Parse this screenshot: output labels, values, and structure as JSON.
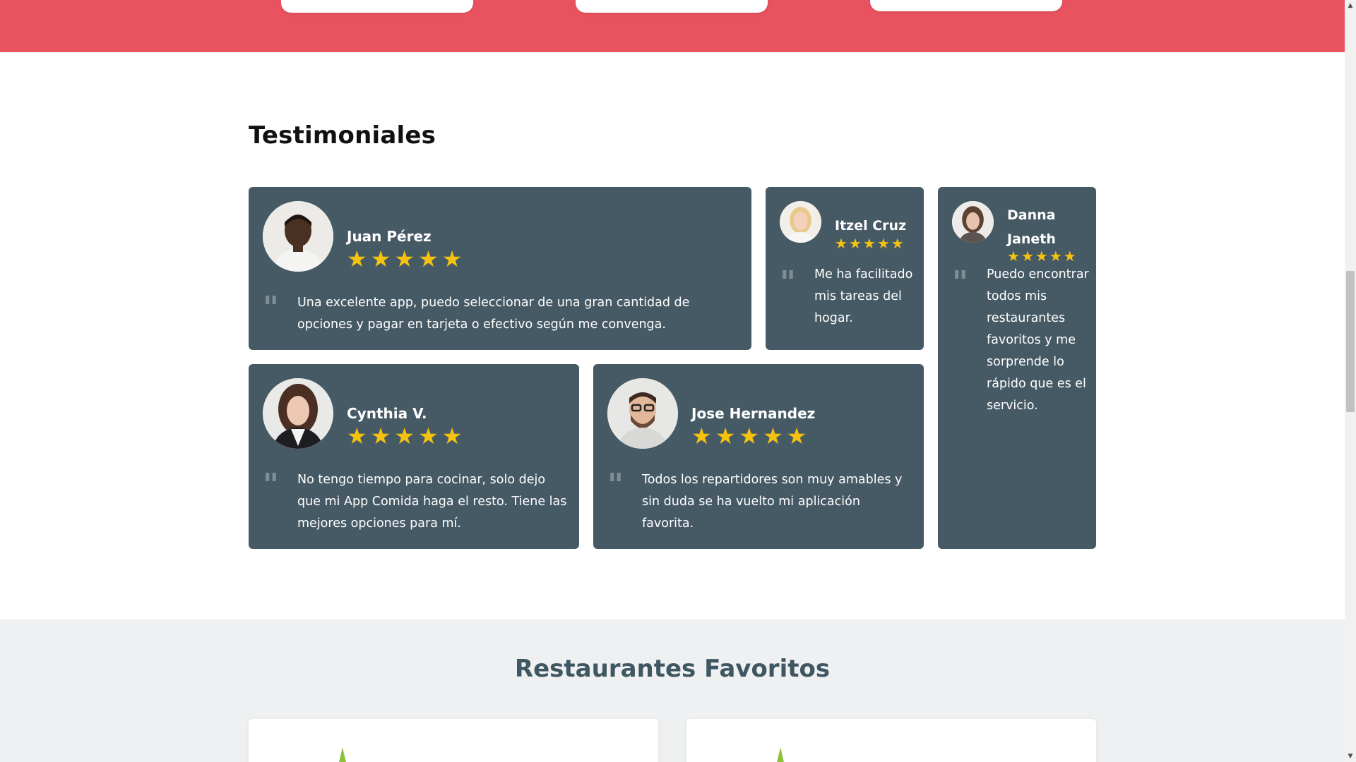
{
  "testimonials": {
    "title": "Testimoniales",
    "items": [
      {
        "name": "Juan Pérez",
        "rating": 5,
        "text": "Una excelente app, puedo seleccionar de una gran cantidad de opciones y pagar en tarjeta o efectivo según me convenga."
      },
      {
        "name": "Itzel Cruz",
        "rating": 5,
        "text": "Me ha facilitado mis tareas del hogar."
      },
      {
        "name": "Danna Janeth",
        "rating": 5,
        "text": "Puedo encontrar todos mis restaurantes favoritos y me sorprende lo rápido que es el servicio."
      },
      {
        "name": "Cynthia V.",
        "rating": 5,
        "text": "No tengo tiempo para cocinar, solo dejo que mi App Comida haga el resto. Tiene las mejores opciones para mí."
      },
      {
        "name": "Jose Hernandez",
        "rating": 5,
        "text": "Todos los repartidores son muy amables y sin duda se ha vuelto mi aplicación favorita."
      }
    ],
    "quote_glyph": "\"",
    "star_glyph": "★"
  },
  "favorites": {
    "title": "Restaurantes Favoritos"
  },
  "colors": {
    "top_band": "#e9535f",
    "card_bg": "#465a65",
    "star": "#f5c20f",
    "favorites_title": "#3f5762",
    "favorites_bg": "#eef0f1"
  },
  "icons": {
    "star": "star-icon",
    "quote": "quote-icon",
    "leaf": "leaf-icon"
  }
}
